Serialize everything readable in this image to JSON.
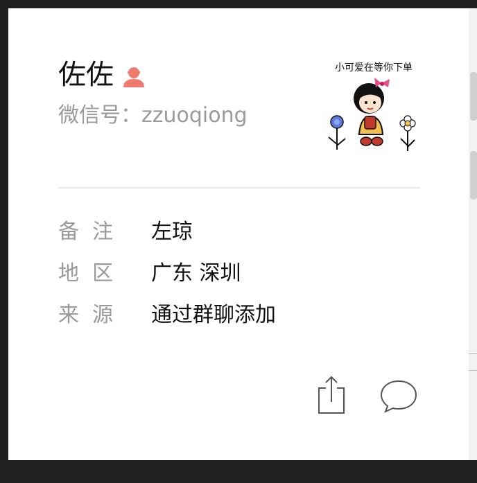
{
  "profile": {
    "name": "佐佐",
    "wechat_id": "微信号：zzuoqiong",
    "avatar_caption": "小可爱在等你下单",
    "gender_icon": "female-user-icon",
    "gender_color": "#f07a6e"
  },
  "details": [
    {
      "label": "备  注",
      "value": "左琼"
    },
    {
      "label": "地  区",
      "value": "广东 深圳"
    },
    {
      "label": "来  源",
      "value": "通过群聊添加"
    }
  ],
  "actions": {
    "share_icon": "share-icon",
    "message_icon": "chat-bubble-icon"
  },
  "colors": {
    "background": "#1f1f1f",
    "card": "#ffffff",
    "text": "#111111",
    "muted": "#9a9a9a"
  }
}
